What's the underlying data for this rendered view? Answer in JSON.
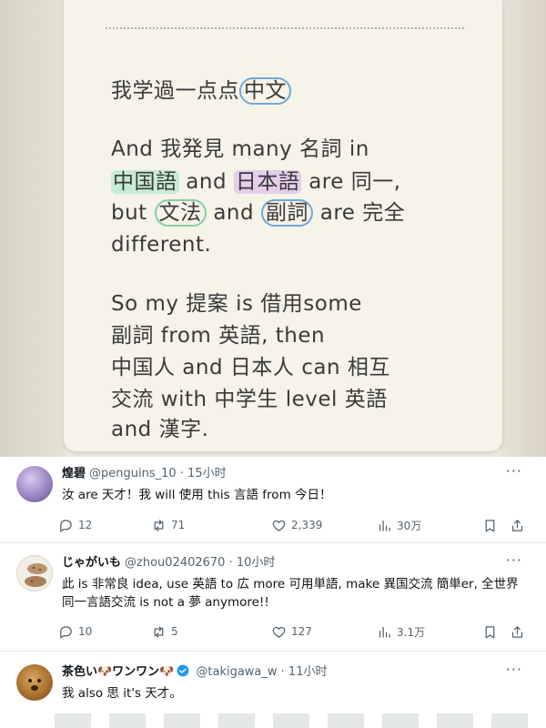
{
  "note": {
    "line1a": "我学過一点点",
    "line1b": "中文",
    "line2": "And 我発見 many 名詞 in",
    "line3a": "中国語",
    "line3b": " and ",
    "line3c": "日本語",
    "line3d": " are 同一,",
    "line4a": "but ",
    "line4b": "文法",
    "line4c": " and ",
    "line4d": "副詞",
    "line4e": " are 完全",
    "line5": "different.",
    "line6": "So my 提案 is 借用some",
    "line7": "副詞 from 英語, then",
    "line8": "中国人 and 日本人 can 相互",
    "line9": "交流 with 中学生 level 英語",
    "line10": "and 漢字."
  },
  "tweets": [
    {
      "name": "煌碧",
      "handle": "@penguins_10 · 15小时",
      "text": "汝 are 天才！我 will 使用 this 言語 from 今日！",
      "replies": "12",
      "retweets": "71",
      "likes": "2,339",
      "views": "30万"
    },
    {
      "name": "じゃがいも",
      "handle": "@zhou02402670 · 10小时",
      "text": "此 is 非常良 idea, use 英語 to 広 more 可用単語, make 異国交流 簡単er, 全世界同一言語交流 is not a 夢 anymore!!",
      "replies": "10",
      "retweets": "5",
      "likes": "127",
      "views": "3.1万"
    },
    {
      "name": "茶色い🐶ワンワン🐶",
      "handle": "@takigawa_w · 11小时",
      "text": "我 also 思 it's 天才。"
    }
  ],
  "icons": {
    "more": "more-icon",
    "reply": "reply-icon",
    "retweet": "retweet-icon",
    "like": "heart-icon",
    "views": "views-icon",
    "bookmark": "bookmark-icon",
    "share": "share-icon"
  },
  "colors": {
    "text": "#0f1419",
    "secondary": "#536471",
    "verified": "#1d9bf0",
    "highlight_green": "#c8ecd2",
    "highlight_purple": "#e5cdec"
  }
}
